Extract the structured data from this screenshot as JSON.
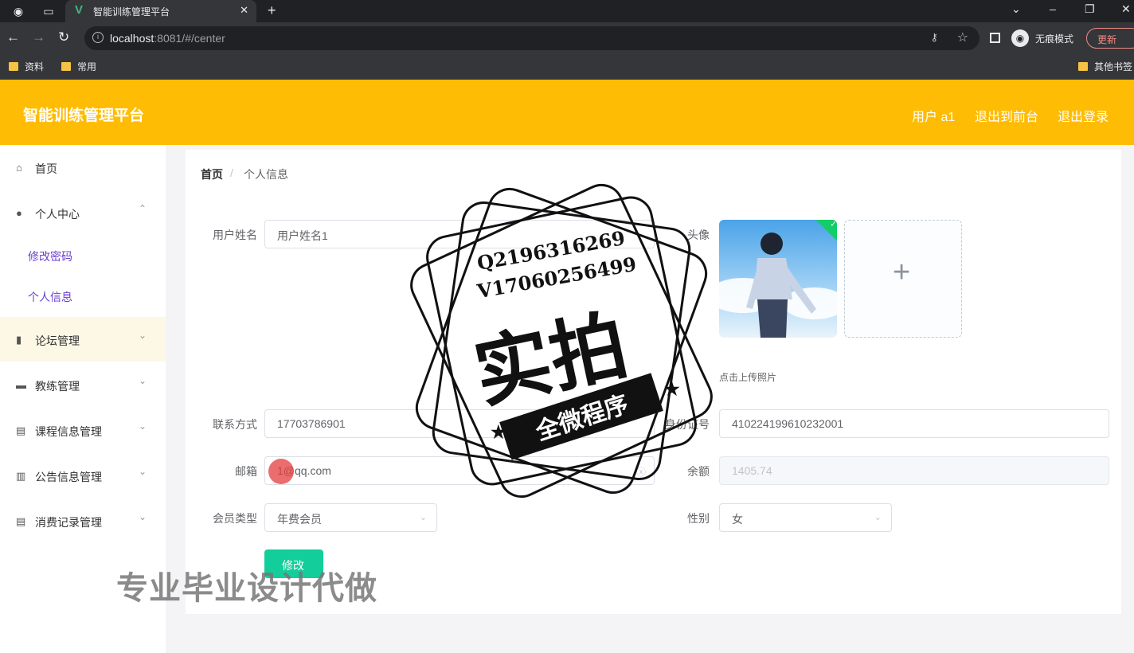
{
  "browser": {
    "tab_title": "智能训练管理平台",
    "url_host": "localhost",
    "url_rest": ":8081/#/center",
    "incognito_label": "无痕模式",
    "update_label": "更新",
    "bookmarks": [
      "资料",
      "常用"
    ],
    "other_bookmarks": "其他书签"
  },
  "header": {
    "title": "智能训练管理平台",
    "user": "用户 a1",
    "to_front": "退出到前台",
    "logout": "退出登录"
  },
  "sidebar": {
    "items": [
      {
        "label": "首页",
        "icon": "home-icon"
      },
      {
        "label": "个人中心",
        "icon": "user-icon"
      },
      {
        "label": "论坛管理",
        "icon": "chart-icon"
      },
      {
        "label": "教练管理",
        "icon": "briefcase-icon"
      },
      {
        "label": "课程信息管理",
        "icon": "clipboard-icon"
      },
      {
        "label": "公告信息管理",
        "icon": "columns-icon"
      },
      {
        "label": "消费记录管理",
        "icon": "document-icon"
      }
    ],
    "sub_items": [
      "修改密码",
      "个人信息"
    ]
  },
  "breadcrumb": {
    "home": "首页",
    "current": "个人信息"
  },
  "form": {
    "username_label": "用户姓名",
    "username_value": "用户姓名1",
    "avatar_label": "头像",
    "upload_tip": "点击上传照片",
    "phone_label": "联系方式",
    "phone_value": "17703786901",
    "idcard_label": "身份证号",
    "idcard_value": "410224199610232001",
    "email_label": "邮箱",
    "email_value": "1@qq.com",
    "balance_label": "余额",
    "balance_value": "1405.74",
    "member_label": "会员类型",
    "member_value": "年费会员",
    "gender_label": "性别",
    "gender_value": "女",
    "submit_label": "修改"
  },
  "overlay": {
    "qq": "Q2196316269",
    "vx": "V17060256499",
    "big": "实拍",
    "ribbon": "全微程序",
    "watermark": "专业毕业设计代做"
  },
  "colors": {
    "header": "#ffbc05",
    "accent": "#13ce9a",
    "submenu": "#6b3fd0"
  }
}
